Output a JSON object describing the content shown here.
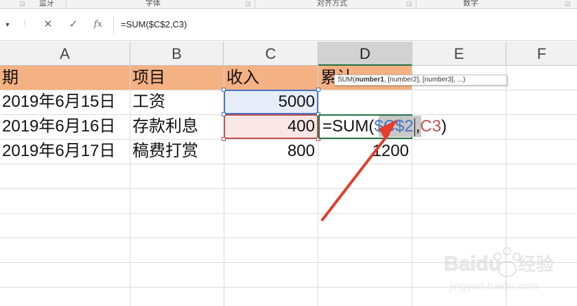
{
  "ribbon": {
    "groups": [
      "监牙",
      "字体",
      "对齐方式",
      "数字"
    ]
  },
  "formula_bar": {
    "cancel_symbol": "✕",
    "enter_symbol": "✓",
    "fx_symbol": "fx",
    "formula": "=SUM($C$2,C3)"
  },
  "columns": [
    "A",
    "B",
    "C",
    "D",
    "E",
    "F"
  ],
  "table": {
    "headers": [
      "期",
      "项目",
      "收入",
      "累计"
    ],
    "rows": [
      {
        "date": "2019年6月15日",
        "item": "工资",
        "income": "5000",
        "total": ""
      },
      {
        "date": "2019年6月16日",
        "item": "存款利息",
        "income": "400",
        "total": ""
      },
      {
        "date": "2019年6月17日",
        "item": "稿费打赏",
        "income": "800",
        "total": "1200"
      }
    ]
  },
  "editing": {
    "prefix": "=SUM(",
    "ref1": "$C$2",
    "comma": ",",
    "ref2": "C3",
    "suffix": ")"
  },
  "tooltip": {
    "fn": "SUM(",
    "arg1": "number1",
    "rest": ", [number2], [number3], ...)"
  },
  "watermark": {
    "brand": "Baidu",
    "suffix": "经验",
    "url": "jingyan.baidu.com"
  },
  "colors": {
    "header_fill": "#f4b183",
    "ref_blue": "#4472c4",
    "ref_red": "#c0504d",
    "active_border": "#217346",
    "arrow": "#e53b2c"
  }
}
